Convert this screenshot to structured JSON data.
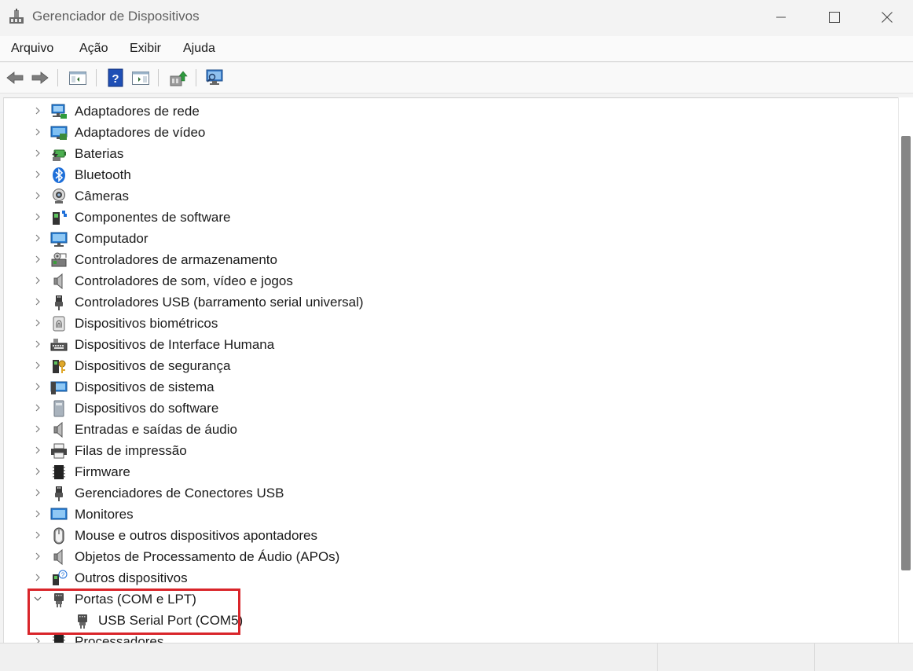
{
  "window": {
    "title": "Gerenciador de Dispositivos",
    "app_icon": "device-manager-icon"
  },
  "menu": {
    "items": [
      {
        "label": "Arquivo"
      },
      {
        "label": "Ação"
      },
      {
        "label": "Exibir"
      },
      {
        "label": "Ajuda"
      }
    ]
  },
  "toolbar": {
    "buttons": [
      "back-arrow-icon",
      "forward-arrow-icon",
      "show-hide-console-tree-icon",
      "help-icon",
      "show-hide-action-pane-icon",
      "update-driver-icon",
      "scan-hardware-icon"
    ]
  },
  "tree": {
    "items": [
      {
        "label": "Adaptadores de rede",
        "icon": "network-adapter-icon",
        "expanded": false
      },
      {
        "label": "Adaptadores de vídeo",
        "icon": "display-adapter-icon",
        "expanded": false
      },
      {
        "label": "Baterias",
        "icon": "battery-icon",
        "expanded": false
      },
      {
        "label": "Bluetooth",
        "icon": "bluetooth-icon",
        "expanded": false
      },
      {
        "label": "Câmeras",
        "icon": "camera-icon",
        "expanded": false
      },
      {
        "label": "Componentes de software",
        "icon": "software-component-icon",
        "expanded": false
      },
      {
        "label": "Computador",
        "icon": "computer-icon",
        "expanded": false
      },
      {
        "label": "Controladores de armazenamento",
        "icon": "storage-controller-icon",
        "expanded": false
      },
      {
        "label": "Controladores de som, vídeo e jogos",
        "icon": "speaker-icon",
        "expanded": false
      },
      {
        "label": "Controladores USB (barramento serial universal)",
        "icon": "usb-plug-icon",
        "expanded": false
      },
      {
        "label": "Dispositivos biométricos",
        "icon": "fingerprint-icon",
        "expanded": false
      },
      {
        "label": "Dispositivos de Interface Humana",
        "icon": "hid-keyboard-icon",
        "expanded": false
      },
      {
        "label": "Dispositivos de segurança",
        "icon": "security-key-icon",
        "expanded": false
      },
      {
        "label": "Dispositivos de sistema",
        "icon": "system-device-icon",
        "expanded": false
      },
      {
        "label": "Dispositivos do software",
        "icon": "software-device-icon",
        "expanded": false
      },
      {
        "label": "Entradas e saídas de áudio",
        "icon": "speaker-icon",
        "expanded": false
      },
      {
        "label": "Filas de impressão",
        "icon": "printer-icon",
        "expanded": false
      },
      {
        "label": "Firmware",
        "icon": "chip-icon",
        "expanded": false
      },
      {
        "label": "Gerenciadores de Conectores USB",
        "icon": "usb-plug-icon",
        "expanded": false
      },
      {
        "label": "Monitores",
        "icon": "monitor-icon",
        "expanded": false
      },
      {
        "label": "Mouse e outros dispositivos apontadores",
        "icon": "mouse-icon",
        "expanded": false
      },
      {
        "label": "Objetos de Processamento de Áudio (APOs)",
        "icon": "speaker-icon",
        "expanded": false
      },
      {
        "label": "Outros dispositivos",
        "icon": "unknown-device-icon",
        "expanded": false
      },
      {
        "label": "Portas (COM e LPT)",
        "icon": "port-icon",
        "expanded": true
      },
      {
        "label": "USB Serial Port (COM5)",
        "icon": "port-icon",
        "child": true
      },
      {
        "label": "Processadores",
        "icon": "chip-icon",
        "expanded": false
      }
    ]
  },
  "annotation": {
    "highlight_color": "#d9252a"
  }
}
